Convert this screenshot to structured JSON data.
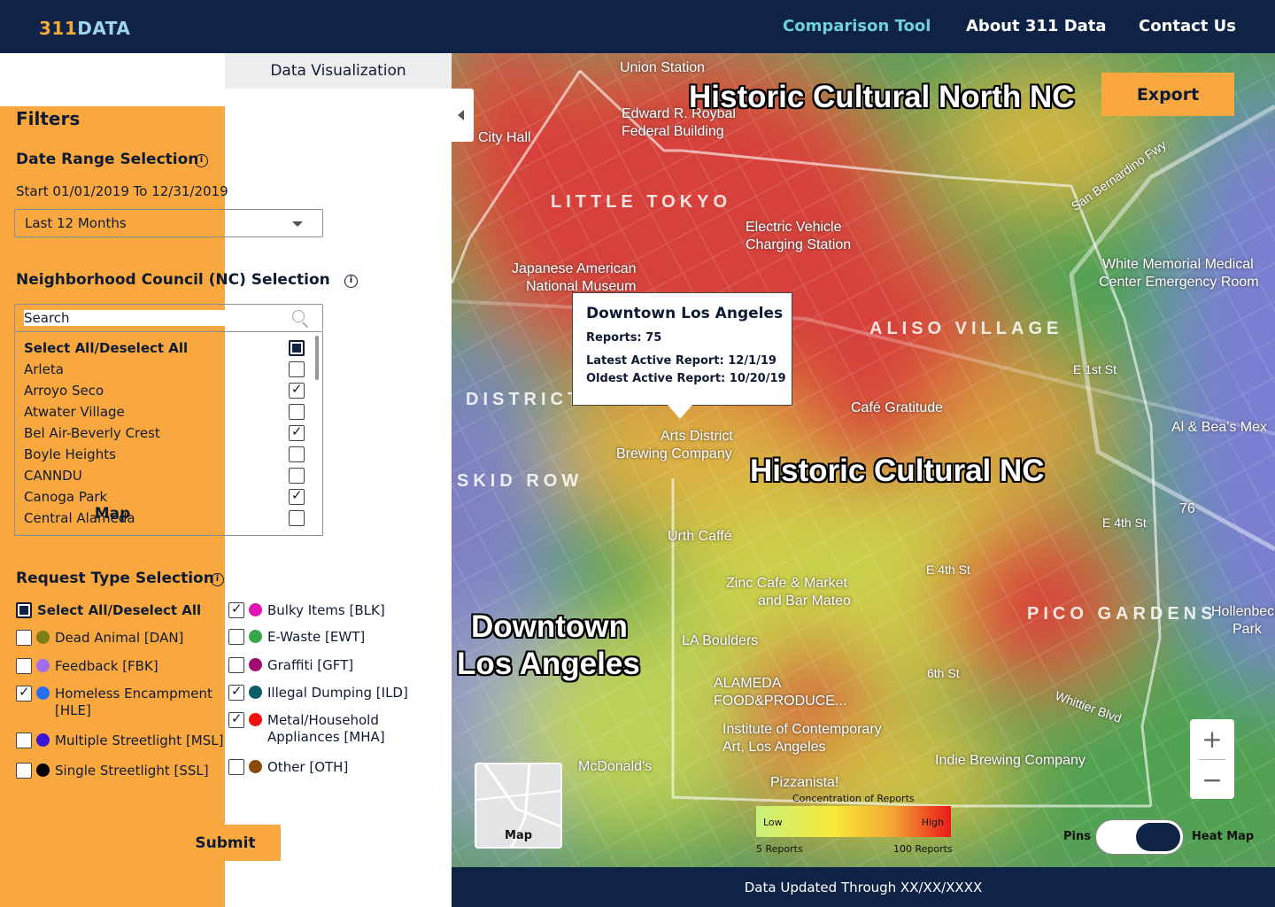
{
  "header": {
    "logo_part1": "311",
    "logo_part2": "DATA",
    "nav": [
      "Comparison Tool",
      "About 311 Data",
      "Contact Us"
    ]
  },
  "tabs": {
    "map": "Map",
    "data_viz": "Data Visualization"
  },
  "filters": {
    "title": "Filters",
    "date": {
      "heading": "Date Range Selection",
      "range_text": "Start 01/01/2019 To 12/31/2019",
      "selected": "Last 12 Months"
    },
    "nc": {
      "heading": "Neighborhood Council (NC) Selection",
      "search_placeholder": "Search",
      "items": [
        {
          "label": "Select All/Deselect All",
          "checked": "partial"
        },
        {
          "label": "Arleta",
          "checked": false
        },
        {
          "label": "Arroyo Seco",
          "checked": true
        },
        {
          "label": "Atwater Village",
          "checked": false
        },
        {
          "label": "Bel Air-Beverly Crest",
          "checked": true
        },
        {
          "label": "Boyle Heights",
          "checked": false
        },
        {
          "label": "CANNDU",
          "checked": false
        },
        {
          "label": "Canoga Park",
          "checked": true
        },
        {
          "label": "Central Alameda",
          "checked": false
        }
      ]
    },
    "request": {
      "heading": "Request Type Selection",
      "select_all": "Select All/Deselect All",
      "left": [
        {
          "label": "Dead Animal [DAN]",
          "color": "#7d7d15",
          "checked": false
        },
        {
          "label": "Feedback [FBK]",
          "color": "#a26cf2",
          "checked": false
        },
        {
          "label": "Homeless Encampment",
          "label2": "[HLE]",
          "color": "#2a6ef0",
          "checked": true
        },
        {
          "label": "Multiple Streetlight [MSL]",
          "color": "#3a17d8",
          "checked": false
        },
        {
          "label": "Single Streetlight [SSL]",
          "color": "#000000",
          "checked": false
        }
      ],
      "right": [
        {
          "label": "Bulky Items [BLK]",
          "color": "#e014b0",
          "checked": true
        },
        {
          "label": "E-Waste [EWT]",
          "color": "#3aa64a",
          "checked": false
        },
        {
          "label": "Graffiti [GFT]",
          "color": "#9e0a6e",
          "checked": false
        },
        {
          "label": "Illegal Dumping [ILD]",
          "color": "#0a5e6a",
          "checked": true
        },
        {
          "label": "Metal/Household",
          "label2": "Appliances [MHA]",
          "color": "#f01010",
          "checked": true
        },
        {
          "label": "Other [OTH]",
          "color": "#8a4a0a",
          "checked": false
        }
      ]
    },
    "submit": "Submit"
  },
  "map": {
    "nc_labels": [
      "Historic Cultural North NC",
      "Historic Cultural NC",
      "Downtown",
      "Los Angeles"
    ],
    "places": [
      "Union Station",
      "Edward R. Roybal",
      "Federal Building",
      "City Hall",
      "LITTLE TOKYO",
      "Electric Vehicle",
      "Charging Station",
      "Japanese American",
      "National Museum",
      "ALISO VILLAGE",
      "White Memorial Medical",
      "Center Emergency Room",
      "Café Gratitude",
      "Arts District",
      "Brewing Company",
      "SKID ROW",
      "DISTRICT",
      "Zinc Cafe & Market",
      "and Bar Mateo",
      "LA Boulders",
      "ALAMEDA",
      "FOOD&PRODUCE...",
      "Institute of Contemporary",
      "Art, Los Angeles",
      "Indie Brewing Company",
      "Pizzanista!",
      "McDonald's",
      "PICO GARDENS",
      "Al & Bea's Mex",
      "Urth Caffé",
      "E 1st St",
      "E 4th St",
      "6th St",
      "Whittier Blvd",
      "San Bernardino Fwy",
      "Hollenbeck",
      "Park",
      "E 4th St",
      "76"
    ],
    "export": "Export",
    "popup": {
      "title": "Downtown Los Angeles",
      "reports": "Reports: 75",
      "latest": "Latest Active Report: 12/1/19",
      "oldest": "Oldest Active Report: 10/20/19"
    },
    "minimap_label": "Map",
    "legend": {
      "title": "Concentration of Reports",
      "low": "Low",
      "high": "High",
      "min": "5 Reports",
      "max": "100 Reports"
    },
    "zoom_in": "+",
    "zoom_out": "−",
    "toggle_left": "Pins",
    "toggle_right": "Heat Map",
    "mode": "Heat Map"
  },
  "footer": {
    "text": "Data Updated Through XX/XX/XXXX"
  }
}
